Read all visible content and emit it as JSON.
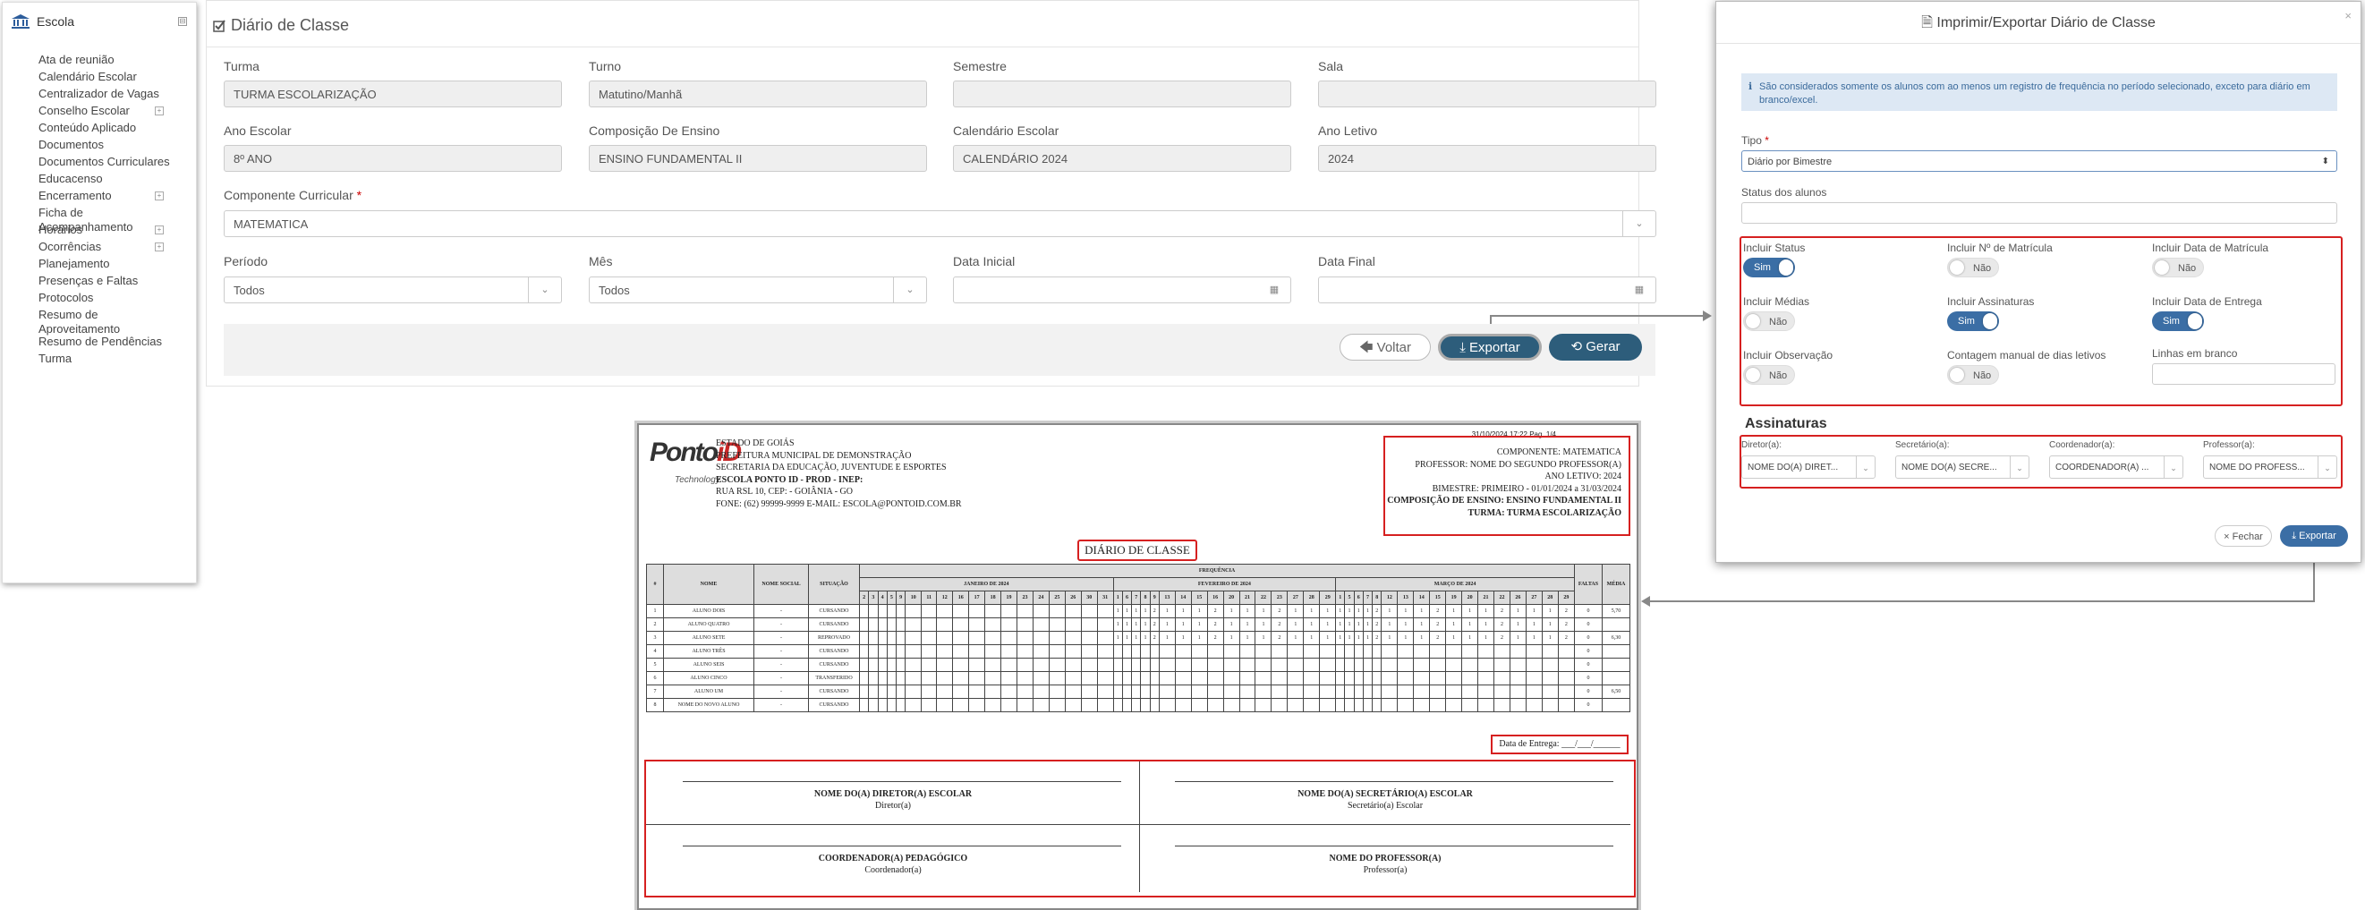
{
  "sidebar": {
    "header": "Escola",
    "collapse_icon": "⊟",
    "items": [
      {
        "label": "Ata de reunião",
        "expandable": false
      },
      {
        "label": "Calendário Escolar",
        "expandable": false
      },
      {
        "label": "Centralizador de Vagas",
        "expandable": false
      },
      {
        "label": "Conselho Escolar",
        "expandable": true
      },
      {
        "label": "Conteúdo Aplicado",
        "expandable": false
      },
      {
        "label": "Documentos",
        "expandable": false
      },
      {
        "label": "Documentos Curriculares",
        "expandable": false
      },
      {
        "label": "Educacenso",
        "expandable": false
      },
      {
        "label": "Encerramento",
        "expandable": true
      },
      {
        "label": "Ficha de Acompanhamento",
        "expandable": false
      },
      {
        "label": "Horários",
        "expandable": true
      },
      {
        "label": "Ocorrências",
        "expandable": true
      },
      {
        "label": "Planejamento",
        "expandable": false
      },
      {
        "label": "Presenças e Faltas",
        "expandable": false
      },
      {
        "label": "Protocolos",
        "expandable": false
      },
      {
        "label": "Resumo de Aproveitamento",
        "expandable": false
      },
      {
        "label": "Resumo de Pendências",
        "expandable": false
      },
      {
        "label": "Turma",
        "expandable": false
      }
    ]
  },
  "form": {
    "title": "Diário de Classe",
    "fields": {
      "turma": {
        "label": "Turma",
        "value": "TURMA ESCOLARIZAÇÃO"
      },
      "turno": {
        "label": "Turno",
        "value": "Matutino/Manhã"
      },
      "semestre": {
        "label": "Semestre",
        "value": ""
      },
      "sala": {
        "label": "Sala",
        "value": ""
      },
      "ano_escolar": {
        "label": "Ano Escolar",
        "value": "8º ANO"
      },
      "composicao": {
        "label": "Composição De Ensino",
        "value": "ENSINO FUNDAMENTAL II"
      },
      "calendario": {
        "label": "Calendário Escolar",
        "value": "CALENDÁRIO 2024"
      },
      "ano_letivo": {
        "label": "Ano Letivo",
        "value": "2024"
      },
      "componente": {
        "label": "Componente Curricular",
        "required_mark": "*",
        "value": "MATEMATICA"
      },
      "periodo": {
        "label": "Período",
        "value": "Todos"
      },
      "mes": {
        "label": "Mês",
        "value": "Todos"
      },
      "data_inicial": {
        "label": "Data Inicial",
        "value": ""
      },
      "data_final": {
        "label": "Data Final",
        "value": ""
      }
    },
    "buttons": {
      "voltar": "Voltar",
      "exportar": "Exportar",
      "gerar": "Gerar"
    }
  },
  "modal": {
    "title": "Imprimir/Exportar Diário de Classe",
    "close": "×",
    "info": "São considerados somente os alunos com ao menos um registro de frequência no período selecionado, exceto para diário em branco/excel.",
    "tipo": {
      "label": "Tipo",
      "required_mark": "*",
      "value": "Diário por Bimestre"
    },
    "status_alunos": {
      "label": "Status dos alunos",
      "value": ""
    },
    "toggles": [
      {
        "label": "Incluir Status",
        "value": "Sim",
        "on": true
      },
      {
        "label": "Incluir Nº de Matrícula",
        "value": "Não",
        "on": false
      },
      {
        "label": "Incluir Data de Matrícula",
        "value": "Não",
        "on": false
      },
      {
        "label": "Incluir Médias",
        "value": "Não",
        "on": false
      },
      {
        "label": "Incluir Assinaturas",
        "value": "Sim",
        "on": true
      },
      {
        "label": "Incluir Data de Entrega",
        "value": "Sim",
        "on": true
      },
      {
        "label": "Incluir Observação",
        "value": "Não",
        "on": false
      },
      {
        "label": "Contagem manual de dias letivos",
        "value": "Não",
        "on": false
      }
    ],
    "linhas_branco": {
      "label": "Linhas em branco",
      "value": ""
    },
    "assinaturas": {
      "title": "Assinaturas",
      "fields": [
        {
          "label": "Diretor(a):",
          "value": "NOME DO(A) DIRET..."
        },
        {
          "label": "Secretário(a):",
          "value": "NOME DO(A) SECRE..."
        },
        {
          "label": "Coordenador(a):",
          "value": "COORDENADOR(A) ..."
        },
        {
          "label": "Professor(a):",
          "value": "NOME DO PROFESS..."
        }
      ]
    },
    "buttons": {
      "fechar": "Fechar",
      "exportar": "Exportar"
    }
  },
  "document": {
    "printed_at": "31/10/2024 17:22  Pag. 1/4",
    "logo": {
      "word": "Ponto",
      "id": "iD",
      "sub": "Technology"
    },
    "school_lines": [
      {
        "text": "ESTADO DE GOIÁS",
        "bold": false
      },
      {
        "text": "PREFEITURA MUNICIPAL DE DEMONSTRAÇÃO",
        "bold": false
      },
      {
        "text": "SECRETARIA DA EDUCAÇÃO, JUVENTUDE E ESPORTES",
        "bold": false
      },
      {
        "text": "ESCOLA PONTO ID - PROD - INEP:",
        "bold": true
      },
      {
        "text": "RUA RSL 10, CEP:            - GOIÂNIA - GO",
        "bold": false
      },
      {
        "text": "FONE: (62) 99999-9999 E-MAIL: ESCOLA@PONTOID.COM.BR",
        "bold": false
      }
    ],
    "info_lines": [
      {
        "text": "COMPONENTE: MATEMATICA",
        "bold": false
      },
      {
        "text": "PROFESSOR: NOME DO SEGUNDO PROFESSOR(A)",
        "bold": false
      },
      {
        "text": "ANO LETIVO: 2024",
        "bold": false
      },
      {
        "text": "BIMESTRE: PRIMEIRO - 01/01/2024 a 31/03/2024",
        "bold": false
      },
      {
        "text": "COMPOSIÇÃO DE ENSINO: ENSINO FUNDAMENTAL II",
        "bold": true
      },
      {
        "text": "TURMA: TURMA ESCOLARIZAÇÃO",
        "bold": true
      }
    ],
    "title": "DIÁRIO DE CLASSE",
    "table": {
      "headers": {
        "num": "#",
        "nome": "NOME",
        "social": "NOME SOCIAL",
        "situacao": "SITUAÇÃO",
        "frequencia": "FREQUÊNCIA",
        "faltas": "FALTAS",
        "media": "MÉDIA"
      },
      "months": [
        {
          "label": "JANEIRO DE 2024",
          "days": [
            "2",
            "3",
            "4",
            "5",
            "9",
            "10",
            "11",
            "12",
            "16",
            "17",
            "18",
            "19",
            "23",
            "24",
            "25",
            "26",
            "30",
            "31"
          ]
        },
        {
          "label": "FEVEREIRO DE 2024",
          "days": [
            "1",
            "6",
            "7",
            "8",
            "9",
            "13",
            "14",
            "15",
            "16",
            "20",
            "21",
            "22",
            "23",
            "27",
            "28",
            "29"
          ]
        },
        {
          "label": "MARÇO DE 2024",
          "days": [
            "1",
            "5",
            "6",
            "7",
            "8",
            "12",
            "13",
            "14",
            "15",
            "19",
            "20",
            "21",
            "22",
            "26",
            "27",
            "28",
            "29"
          ]
        }
      ],
      "rows": [
        {
          "num": "1",
          "nome": "ALUNO DOIS",
          "social": "-",
          "situacao": "CURSANDO",
          "marks": true,
          "faltas": "0",
          "media": "5,70"
        },
        {
          "num": "2",
          "nome": "ALUNO QUATRO",
          "social": "-",
          "situacao": "CURSANDO",
          "marks": true,
          "faltas": "0",
          "media": ""
        },
        {
          "num": "3",
          "nome": "ALUNO SETE",
          "social": "-",
          "situacao": "REPROVADO",
          "marks": true,
          "faltas": "0",
          "media": "6,30"
        },
        {
          "num": "4",
          "nome": "ALUNO TRÊS",
          "social": "-",
          "situacao": "CURSANDO",
          "marks": false,
          "faltas": "0",
          "media": ""
        },
        {
          "num": "5",
          "nome": "ALUNO SEIS",
          "social": "-",
          "situacao": "CURSANDO",
          "marks": false,
          "faltas": "0",
          "media": ""
        },
        {
          "num": "6",
          "nome": "ALUNO CINCO",
          "social": "-",
          "situacao": "TRANSFERIDO",
          "marks": false,
          "faltas": "0",
          "media": ""
        },
        {
          "num": "7",
          "nome": "ALUNO UM",
          "social": "-",
          "situacao": "CURSANDO",
          "marks": false,
          "faltas": "0",
          "media": "6,50"
        },
        {
          "num": "8",
          "nome": "NOME DO NOVO ALUNO",
          "social": "-",
          "situacao": "CURSANDO",
          "marks": false,
          "faltas": "0",
          "media": ""
        }
      ],
      "mark_pattern": [
        "1",
        "1",
        "1",
        "1",
        "2",
        "1",
        "1",
        "1",
        "2",
        "1",
        "1",
        "1",
        "2",
        "1",
        "1",
        "1",
        "2",
        "1"
      ]
    },
    "entrega": "Data de Entrega: ___/___/______",
    "signatures": [
      {
        "name": "NOME DO(A) DIRETOR(A) ESCOLAR",
        "role": "Diretor(a)"
      },
      {
        "name": "NOME DO(A) SECRETÁRIO(A) ESCOLAR",
        "role": "Secretário(a) Escolar"
      },
      {
        "name": "COORDENADOR(A) PEDAGÓGICO",
        "role": "Coordenador(a)"
      },
      {
        "name": "NOME DO PROFESSOR(A)",
        "role": "Professor(a)"
      }
    ]
  },
  "colors": {
    "primary": "#2d5d7b",
    "highlight": "#d62020",
    "toggle_on": "#3b6ea5",
    "info_bg": "#dde8f4"
  }
}
